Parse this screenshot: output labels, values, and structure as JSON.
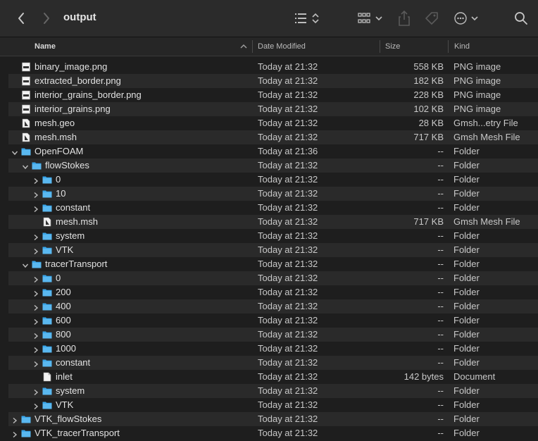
{
  "window": {
    "title": "output"
  },
  "toolbar": {
    "back_icon": "chevron-left-icon",
    "forward_icon": "chevron-right-icon",
    "list_view_icon": "list-view-icon",
    "grid_view_icon": "grid-view-icon",
    "share_icon": "share-icon",
    "tag_icon": "tag-icon",
    "more_icon": "ellipsis-icon",
    "search_icon": "search-icon"
  },
  "columns": {
    "name": "Name",
    "date": "Date Modified",
    "size": "Size",
    "kind": "Kind"
  },
  "colors": {
    "folder": "#3aa6ea",
    "background": "#1e1e1e",
    "alt_row": "#2a2a2a"
  },
  "rows": [
    {
      "name": "binary_image.png",
      "date": "Today at 21:32",
      "size": "558 KB",
      "kind": "PNG image",
      "icon": "image-file-icon",
      "depth": 0,
      "disclosure": "none"
    },
    {
      "name": "extracted_border.png",
      "date": "Today at 21:32",
      "size": "182 KB",
      "kind": "PNG image",
      "icon": "image-file-icon",
      "depth": 0,
      "disclosure": "none"
    },
    {
      "name": "interior_grains_border.png",
      "date": "Today at 21:32",
      "size": "228 KB",
      "kind": "PNG image",
      "icon": "image-file-icon",
      "depth": 0,
      "disclosure": "none"
    },
    {
      "name": "interior_grains.png",
      "date": "Today at 21:32",
      "size": "102 KB",
      "kind": "PNG image",
      "icon": "image-file-icon",
      "depth": 0,
      "disclosure": "none"
    },
    {
      "name": "mesh.geo",
      "date": "Today at 21:32",
      "size": "28 KB",
      "kind": "Gmsh...etry File",
      "icon": "gmsh-file-icon",
      "depth": 0,
      "disclosure": "none"
    },
    {
      "name": "mesh.msh",
      "date": "Today at 21:32",
      "size": "717 KB",
      "kind": "Gmsh Mesh File",
      "icon": "gmsh-file-icon",
      "depth": 0,
      "disclosure": "none"
    },
    {
      "name": "OpenFOAM",
      "date": "Today at 21:36",
      "size": "--",
      "kind": "Folder",
      "icon": "folder-icon",
      "depth": 0,
      "disclosure": "open"
    },
    {
      "name": "flowStokes",
      "date": "Today at 21:32",
      "size": "--",
      "kind": "Folder",
      "icon": "folder-icon",
      "depth": 1,
      "disclosure": "open"
    },
    {
      "name": "0",
      "date": "Today at 21:32",
      "size": "--",
      "kind": "Folder",
      "icon": "folder-icon",
      "depth": 2,
      "disclosure": "closed"
    },
    {
      "name": "10",
      "date": "Today at 21:32",
      "size": "--",
      "kind": "Folder",
      "icon": "folder-icon",
      "depth": 2,
      "disclosure": "closed"
    },
    {
      "name": "constant",
      "date": "Today at 21:32",
      "size": "--",
      "kind": "Folder",
      "icon": "folder-icon",
      "depth": 2,
      "disclosure": "closed"
    },
    {
      "name": "mesh.msh",
      "date": "Today at 21:32",
      "size": "717 KB",
      "kind": "Gmsh Mesh File",
      "icon": "gmsh-file-icon",
      "depth": 2,
      "disclosure": "none"
    },
    {
      "name": "system",
      "date": "Today at 21:32",
      "size": "--",
      "kind": "Folder",
      "icon": "folder-icon",
      "depth": 2,
      "disclosure": "closed"
    },
    {
      "name": "VTK",
      "date": "Today at 21:32",
      "size": "--",
      "kind": "Folder",
      "icon": "folder-icon",
      "depth": 2,
      "disclosure": "closed"
    },
    {
      "name": "tracerTransport",
      "date": "Today at 21:32",
      "size": "--",
      "kind": "Folder",
      "icon": "folder-icon",
      "depth": 1,
      "disclosure": "open"
    },
    {
      "name": "0",
      "date": "Today at 21:32",
      "size": "--",
      "kind": "Folder",
      "icon": "folder-icon",
      "depth": 2,
      "disclosure": "closed"
    },
    {
      "name": "200",
      "date": "Today at 21:32",
      "size": "--",
      "kind": "Folder",
      "icon": "folder-icon",
      "depth": 2,
      "disclosure": "closed"
    },
    {
      "name": "400",
      "date": "Today at 21:32",
      "size": "--",
      "kind": "Folder",
      "icon": "folder-icon",
      "depth": 2,
      "disclosure": "closed"
    },
    {
      "name": "600",
      "date": "Today at 21:32",
      "size": "--",
      "kind": "Folder",
      "icon": "folder-icon",
      "depth": 2,
      "disclosure": "closed"
    },
    {
      "name": "800",
      "date": "Today at 21:32",
      "size": "--",
      "kind": "Folder",
      "icon": "folder-icon",
      "depth": 2,
      "disclosure": "closed"
    },
    {
      "name": "1000",
      "date": "Today at 21:32",
      "size": "--",
      "kind": "Folder",
      "icon": "folder-icon",
      "depth": 2,
      "disclosure": "closed"
    },
    {
      "name": "constant",
      "date": "Today at 21:32",
      "size": "--",
      "kind": "Folder",
      "icon": "folder-icon",
      "depth": 2,
      "disclosure": "closed"
    },
    {
      "name": "inlet",
      "date": "Today at 21:32",
      "size": "142 bytes",
      "kind": "Document",
      "icon": "document-icon",
      "depth": 2,
      "disclosure": "none"
    },
    {
      "name": "system",
      "date": "Today at 21:32",
      "size": "--",
      "kind": "Folder",
      "icon": "folder-icon",
      "depth": 2,
      "disclosure": "closed"
    },
    {
      "name": "VTK",
      "date": "Today at 21:32",
      "size": "--",
      "kind": "Folder",
      "icon": "folder-icon",
      "depth": 2,
      "disclosure": "closed"
    },
    {
      "name": "VTK_flowStokes",
      "date": "Today at 21:32",
      "size": "--",
      "kind": "Folder",
      "icon": "folder-icon",
      "depth": 0,
      "disclosure": "closed"
    },
    {
      "name": "VTK_tracerTransport",
      "date": "Today at 21:32",
      "size": "--",
      "kind": "Folder",
      "icon": "folder-icon",
      "depth": 0,
      "disclosure": "closed"
    }
  ]
}
